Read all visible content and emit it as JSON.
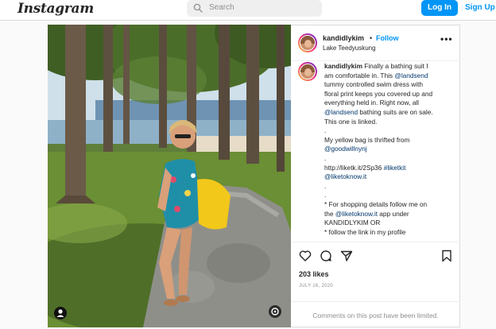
{
  "app": {
    "logo": "Instagram"
  },
  "header": {
    "search_placeholder": "Search",
    "login_label": "Log In",
    "signup_label": "Sign Up"
  },
  "post": {
    "username": "kandidlykim",
    "separator": "•",
    "follow_label": "Follow",
    "location": "Lake Teedyuskung",
    "more": "•••",
    "caption": {
      "author": "kandidlykim",
      "lines": [
        [
          {
            "t": "kandidlykim",
            "s": "b"
          },
          {
            "t": " Finally a bathing suit I"
          }
        ],
        [
          {
            "t": "am comfortable in. This "
          },
          {
            "t": "@landsend",
            "s": "a"
          }
        ],
        [
          {
            "t": "tummy controlled swim dress with"
          }
        ],
        [
          {
            "t": "floral print keeps you covered up and"
          }
        ],
        [
          {
            "t": "everything held in. Right now, all"
          }
        ],
        [
          {
            "t": "@landsend",
            "s": "a"
          },
          {
            "t": " bathing suits are on sale."
          }
        ],
        [
          {
            "t": "This one is linked."
          }
        ],
        [
          {
            "t": "."
          }
        ],
        [
          {
            "t": "My yellow bag is thrifted from"
          }
        ],
        [
          {
            "t": "@goodwillnynj",
            "s": "a"
          }
        ],
        [
          {
            "t": "."
          }
        ],
        [
          {
            "t": "http://liketk.it/2Sp36 "
          },
          {
            "t": "#liketkit",
            "s": "a"
          }
        ],
        [
          {
            "t": "@liketoknow.it",
            "s": "a"
          }
        ],
        [
          {
            "t": "."
          }
        ],
        [
          {
            "t": "."
          }
        ],
        [
          {
            "t": "* For shopping details follow me on"
          }
        ],
        [
          {
            "t": "the "
          },
          {
            "t": "@liketoknow.it",
            "s": "a"
          },
          {
            "t": " app under"
          }
        ],
        [
          {
            "t": "KANDIDLYKIM OR"
          }
        ],
        [
          {
            "t": "* follow the link in my profile"
          }
        ]
      ]
    },
    "likes": "203 likes",
    "date": "JULY 16, 2020",
    "comments_limited": "Comments on this post have been limited.",
    "icons": [
      "heart-icon",
      "comment-icon",
      "share-icon",
      "bookmark-icon"
    ]
  },
  "colors": {
    "accent": "#0095f6",
    "border": "#dbdbdb",
    "muted": "#8e8e8e",
    "link": "#00376b"
  }
}
